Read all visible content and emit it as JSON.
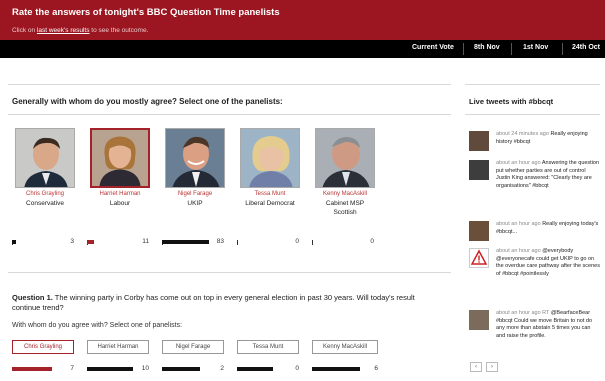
{
  "header": {
    "title": "Rate the answers of tonight's BBC Question Time panelists",
    "sub_prefix": "Click on",
    "sub_link": "last week's results",
    "sub_suffix": "to see the outcome."
  },
  "nav": [
    "Current Vote",
    "8th Nov",
    "1st Nov",
    "24th Oct"
  ],
  "general_question": "Generally with whom do you mostly agree? Select one of the panelists:",
  "panelists": [
    {
      "name": "Chris Grayling",
      "party": "Conservative",
      "count": "3",
      "fill": 0.03,
      "selected": false
    },
    {
      "name": "Harriet Harman",
      "party": "Labour",
      "count": "11",
      "fill": 0.12,
      "selected": true
    },
    {
      "name": "Nigel Farage",
      "party": "UKIP",
      "count": "83",
      "fill": 0.75,
      "selected": false
    },
    {
      "name": "Tessa Munt",
      "party": "Liberal Democrat",
      "count": "0",
      "fill": 0.0,
      "selected": false
    },
    {
      "name": "Kenny MacAskill",
      "party": "Cabinet MSP Scottish",
      "count": "0",
      "fill": 0.0,
      "selected": false
    }
  ],
  "question1": {
    "label": "Question 1.",
    "text": "The winning party in Corby has come out on top in every general election in past 30 years. Will today's result continue trend?",
    "prompt": "With whom do you agree with? Select one of panelists:"
  },
  "q1_counts": [
    "7",
    "10",
    "2",
    "0",
    "6"
  ],
  "sidebar": {
    "title": "Live tweets with #bbcqt",
    "tweets": [
      {
        "meta": "about 24 minutes ago ",
        "text": "Really enjoying history #bbcqt"
      },
      {
        "meta": "about an hour ago ",
        "text": "Answering the question put whether parties are out of control Justin King answered: \"Clearly they are organisations\" #bbcqt"
      },
      {
        "meta": "about an hour ago ",
        "text": "Really enjoying today's #bbcqt..."
      },
      {
        "meta": "about an hour ago ",
        "text": "@everybody @everyonecafe could get UKIP to go on the overdue care pathway after the scenes of #bbcqt #pointlessly"
      },
      {
        "meta": "about an hour ago RT ",
        "text": "@BearfaceBear #bbcqt Could we move Britain to not do any more than abstain 5 times you can and raise the profile."
      }
    ],
    "pager": [
      "‹",
      "›"
    ]
  },
  "colors": {
    "header": "#9b1620",
    "accent": "#a4222a",
    "nav": "#000000"
  }
}
